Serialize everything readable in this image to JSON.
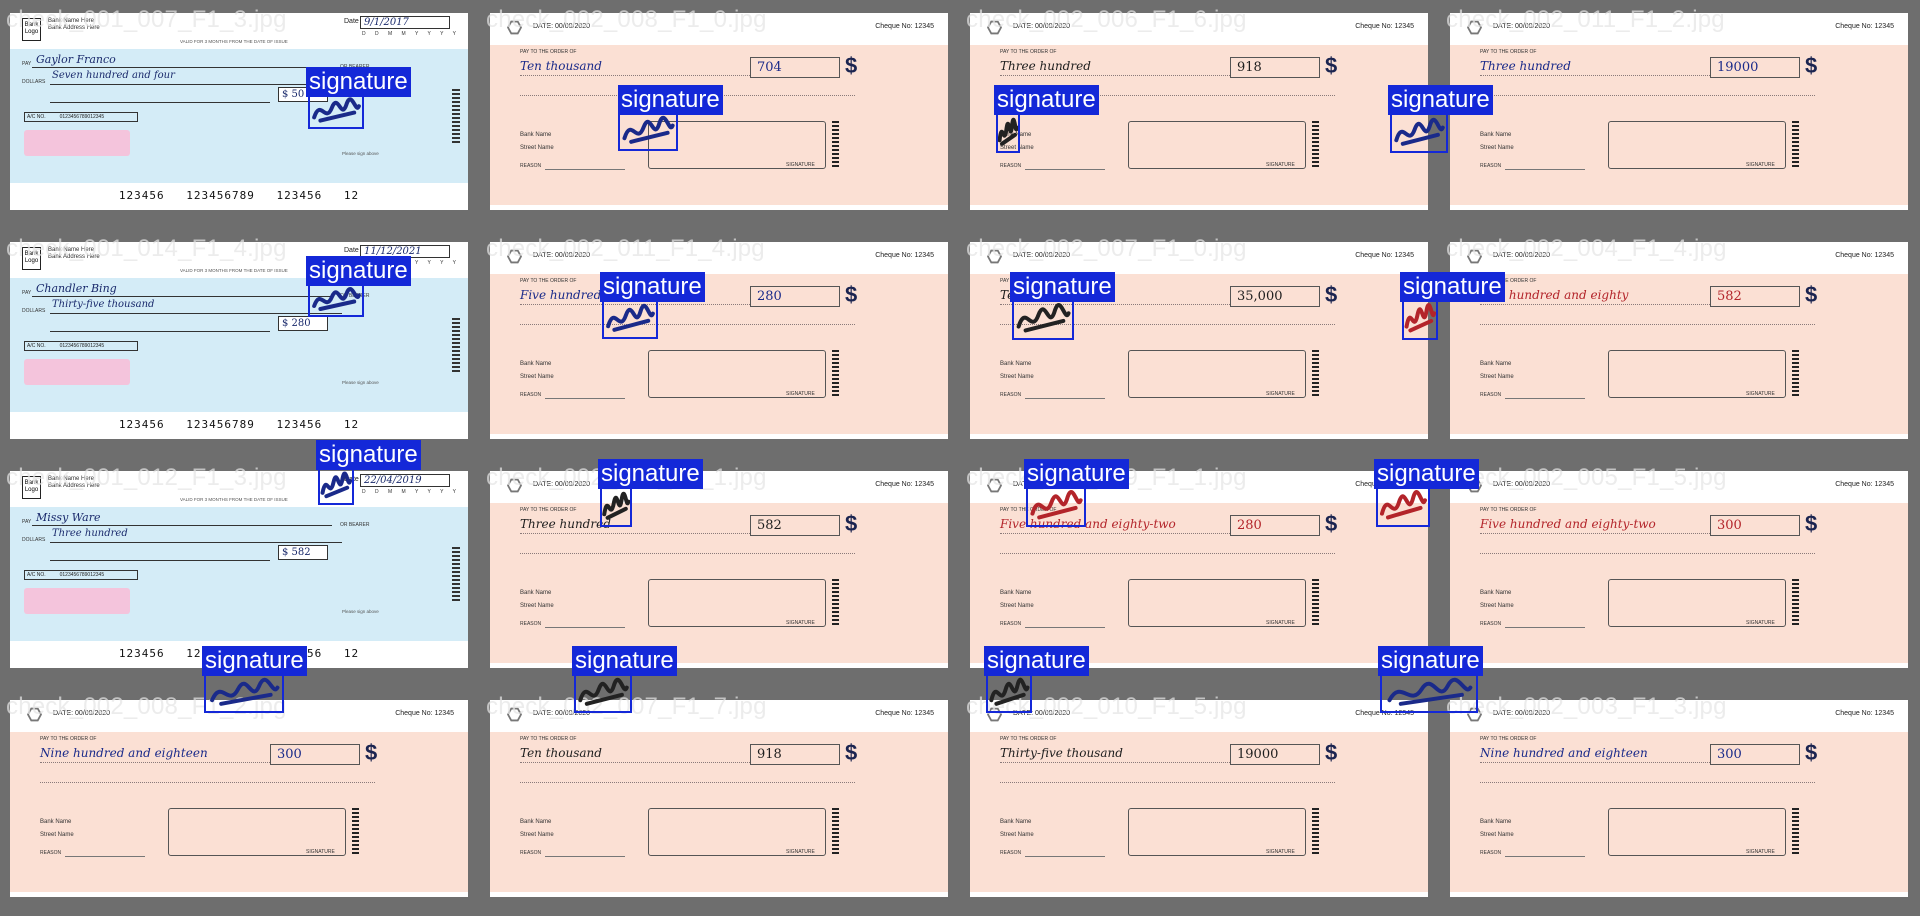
{
  "label": "signature",
  "colors": {
    "box": "#1428d8",
    "ink_blue": "#1a2a8a",
    "ink_red": "#b3242a"
  },
  "blue_template": {
    "logo": "Bank Logo",
    "bank_name": "Bank Name Here",
    "bank_address": "Bank Address Here",
    "date_label": "Date",
    "ddmm": "D D M M Y Y Y Y",
    "pay_label": "PAY",
    "dollars_label": "DOLLARS",
    "or_bearer": "OR BEARER",
    "ac_label": "A/C NO.",
    "ac_number": "0123456789012345",
    "valid_note": "VALID FOR 3 MONTHS FROM THE DATE OF ISSUE",
    "please_sign": "Please sign above",
    "micr": "123456   123456789   123456   12"
  },
  "pink_template": {
    "date": "DATE: 00/00/2020",
    "cheque_no": "Cheque No: 12345",
    "pay_to": "PAY TO THE ORDER OF",
    "bank_name": "Bank Name",
    "street": "Street Name",
    "reason": "REASON",
    "signature_label": "SIGNATURE",
    "dollar": "$"
  },
  "cells": [
    {
      "file": "check_001_007_F1_3.jpg",
      "type": "blue",
      "payee": "Gaylor Franco",
      "words": "Seven hundred and four",
      "amount": "$ 50",
      "date": "9/1/2017"
    },
    {
      "file": "check_002_008_F1_0.jpg",
      "type": "pink",
      "words": "Ten thousand",
      "amount": "704",
      "ink": "blue"
    },
    {
      "file": "check_002_006_F1_6.jpg",
      "type": "pink",
      "words": "Three hundred",
      "amount": "918",
      "ink": "dark"
    },
    {
      "file": "check_002_011_F1_2.jpg",
      "type": "pink",
      "words": "Three hundred",
      "amount": "19000",
      "ink": "blue"
    },
    {
      "file": "check_001_014_F1_4.jpg",
      "type": "blue",
      "payee": "Chandler Bing",
      "words": "Thirty-five thousand",
      "amount": "$ 280",
      "date": "11/12/2021"
    },
    {
      "file": "check_002_011_F1_4.jpg",
      "type": "pink",
      "words": "Five hundred and eighty-two",
      "amount": "280",
      "ink": "blue"
    },
    {
      "file": "check_002_007_F1_0.jpg",
      "type": "pink",
      "words": "Ten thousand",
      "amount": "35,000",
      "ink": "dark"
    },
    {
      "file": "check_002_004_F1_4.jpg",
      "type": "pink",
      "words": "Two hundred and eighty",
      "amount": "582",
      "ink": "red"
    },
    {
      "file": "check_001_012_F1_3.jpg",
      "type": "blue",
      "payee": "Missy Ware",
      "words": "Three hundred",
      "amount": "$ 582",
      "date": "22/04/2019"
    },
    {
      "file": "check_002_012_F1_1.jpg",
      "type": "pink",
      "words": "Three hundred",
      "amount": "582",
      "ink": "dark"
    },
    {
      "file": "check_002_009_F1_1.jpg",
      "type": "pink",
      "words": "Five hundred and eighty-two",
      "amount": "280",
      "ink": "red"
    },
    {
      "file": "check_002_005_F1_5.jpg",
      "type": "pink",
      "words": "Five hundred and eighty-two",
      "amount": "300",
      "ink": "red"
    },
    {
      "file": "check_002_008_F1_2.jpg",
      "type": "pink",
      "words": "Nine hundred and eighteen",
      "amount": "300",
      "ink": "blue"
    },
    {
      "file": "check_002_007_F1_7.jpg",
      "type": "pink",
      "words": "Ten thousand",
      "amount": "918",
      "ink": "dark"
    },
    {
      "file": "check_002_010_F1_5.jpg",
      "type": "pink",
      "words": "Thirty-five thousand",
      "amount": "19000",
      "ink": "dark"
    },
    {
      "file": "check_002_003_F1_3.jpg",
      "type": "pink",
      "words": "Nine hundred and eighteen",
      "amount": "300",
      "ink": "blue"
    }
  ]
}
